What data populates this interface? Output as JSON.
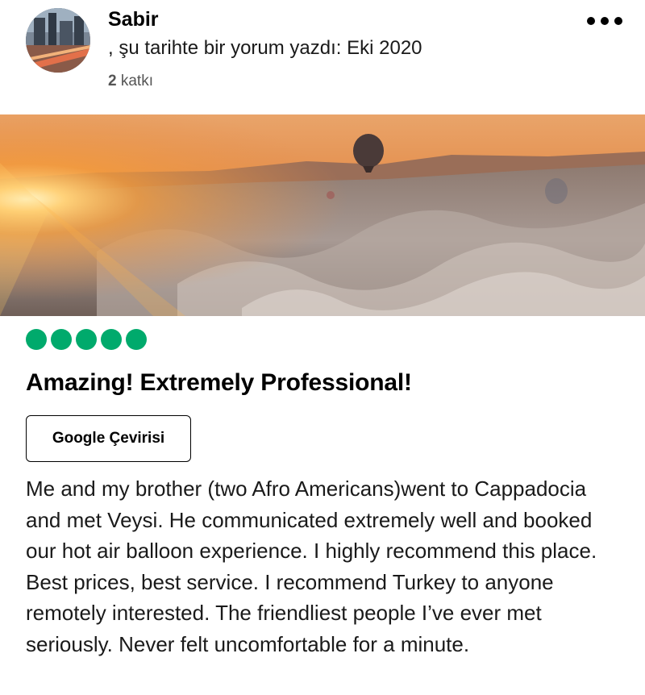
{
  "user": {
    "name": "Sabir",
    "meta": ", şu tarihte bir yorum yazdı: Eki 2020",
    "contributions_count": "2",
    "contributions_label": "katkı"
  },
  "menu": {
    "icon": "more-horizontal-icon"
  },
  "photo": {
    "description_icon": "review-photo"
  },
  "rating": {
    "value": 5,
    "max": 5,
    "color": "#00aa6c"
  },
  "review": {
    "title": "Amazing! Extremely Professional!",
    "translate_label": "Google Çevirisi",
    "body": "Me and my brother (two Afro Americans)went to Cappadocia and met Veysi. He communicated extremely well and booked our hot air balloon experience. I highly recommend this place. Best prices, best service. I recommend Turkey to anyone remotely interested. The friendliest people I’ve ever met seriously. Never felt uncomfortable for a minute."
  }
}
